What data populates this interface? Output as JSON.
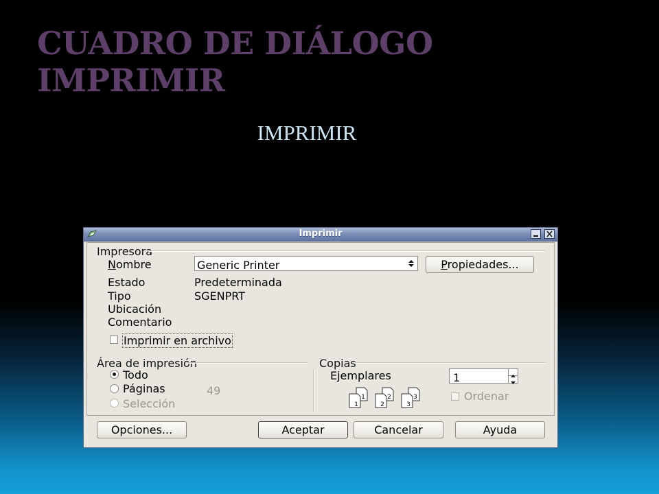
{
  "slide": {
    "title_line1": "CUADRO DE DIÁLOGO",
    "title_line2": "IMPRIMIR",
    "subtitle": "IMPRIMIR"
  },
  "dialog": {
    "title": "Imprimir",
    "icons": {
      "app": "app-icon",
      "minimize": "minimize-icon",
      "close": "close-icon"
    },
    "printer": {
      "group_label": "Impresora",
      "name_label": "Nombre",
      "name_value": "Generic Printer",
      "properties_button": "Propiedades...",
      "status_label": "Estado",
      "status_value": "Predeterminada",
      "type_label": "Tipo",
      "type_value": "SGENPRT",
      "location_label": "Ubicación",
      "comment_label": "Comentario",
      "print_to_file_label": "Imprimir en archivo"
    },
    "print_range": {
      "group_label": "Área de impresión",
      "all_label": "Todo",
      "pages_label": "Páginas",
      "pages_value": "49",
      "selection_label": "Selección",
      "selected": "Todo"
    },
    "copies": {
      "group_label": "Copias",
      "copies_label": "Ejemplares",
      "copies_value": "1",
      "collate_label": "Ordenar",
      "collate_icon_numbers": [
        "1",
        "2",
        "3"
      ]
    },
    "buttons": {
      "options": "Opciones...",
      "ok": "Aceptar",
      "cancel": "Cancelar",
      "help": "Ayuda"
    }
  },
  "colors": {
    "title": "#5e3f6a",
    "subtitle": "#cde6f5",
    "titlebar": "#6075a3",
    "dialog_bg": "#e9e6e0"
  }
}
